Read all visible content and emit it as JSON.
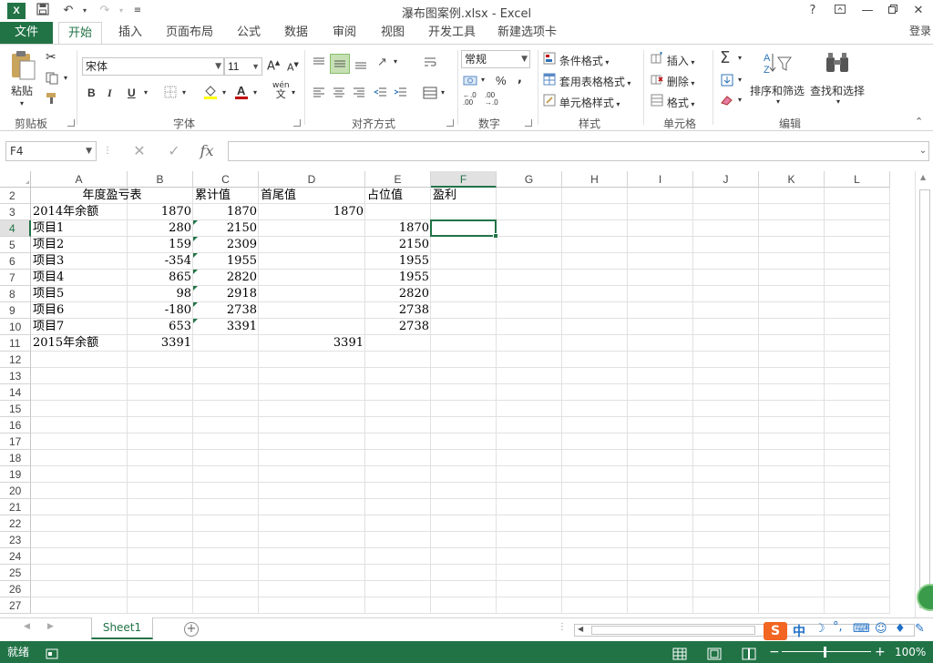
{
  "window": {
    "title": "瀑布图案例.xlsx - Excel",
    "app_icon": "X",
    "help": "?",
    "login": "登录"
  },
  "ribbon_tabs": [
    "文件",
    "开始",
    "插入",
    "页面布局",
    "公式",
    "数据",
    "审阅",
    "视图",
    "开发工具",
    "新建选项卡"
  ],
  "ribbon": {
    "clipboard": {
      "label": "剪贴板",
      "paste": "粘贴"
    },
    "font": {
      "label": "字体",
      "font_name": "宋体",
      "font_size": "11",
      "bold": "B",
      "italic": "I",
      "underline": "U",
      "wen": "wén",
      "wen2": "文"
    },
    "alignment": {
      "label": "对齐方式"
    },
    "number": {
      "label": "数字",
      "format": "常规",
      "percent": "%",
      "comma": ","
    },
    "styles": {
      "label": "样式",
      "conditional": "条件格式",
      "table_format": "套用表格格式",
      "cell_styles": "单元格样式"
    },
    "cells": {
      "label": "单元格",
      "insert": "插入",
      "delete": "删除",
      "format": "格式"
    },
    "editing": {
      "label": "编辑",
      "sort_filter": "排序和筛选",
      "find_select": "查找和选择"
    }
  },
  "formula_bar": {
    "name_box": "F4",
    "fx": "fx",
    "value": ""
  },
  "columns": [
    "A",
    "B",
    "C",
    "D",
    "E",
    "F",
    "G",
    "H",
    "I",
    "J",
    "K",
    "L"
  ],
  "selected_column": "F",
  "selected_row": "4",
  "rows": [
    "2",
    "3",
    "4",
    "5",
    "6",
    "7",
    "8",
    "9",
    "10",
    "11",
    "12",
    "13",
    "14",
    "15",
    "16",
    "17",
    "18",
    "19",
    "20",
    "21",
    "22",
    "23",
    "24",
    "25",
    "26",
    "27"
  ],
  "cells": {
    "A2": "年度盈亏表",
    "C2": "累计值",
    "D2": "首尾值",
    "E2": "占位值",
    "F2": "盈利",
    "A3": "2014年余额",
    "B3": "1870",
    "C3": "1870",
    "D3": "1870",
    "A4": "项目1",
    "B4": "280",
    "C4": "2150",
    "E4": "1870",
    "A5": "项目2",
    "B5": "159",
    "C5": "2309",
    "E5": "2150",
    "A6": "项目3",
    "B6": "-354",
    "C6": "1955",
    "E6": "1955",
    "A7": "项目4",
    "B7": "865",
    "C7": "2820",
    "E7": "1955",
    "A8": "项目5",
    "B8": "98",
    "C8": "2918",
    "E8": "2820",
    "A9": "项目6",
    "B9": "-180",
    "C9": "2738",
    "E9": "2738",
    "A10": "项目7",
    "B10": "653",
    "C10": "3391",
    "E10": "2738",
    "A11": "2015年余额",
    "B11": "3391",
    "D11": "3391"
  },
  "sheets": [
    "Sheet1"
  ],
  "status": {
    "ready": "就绪",
    "zoom": "100%"
  },
  "ime": {
    "brand": "S",
    "lang": "中"
  },
  "accent_color": "#217346"
}
